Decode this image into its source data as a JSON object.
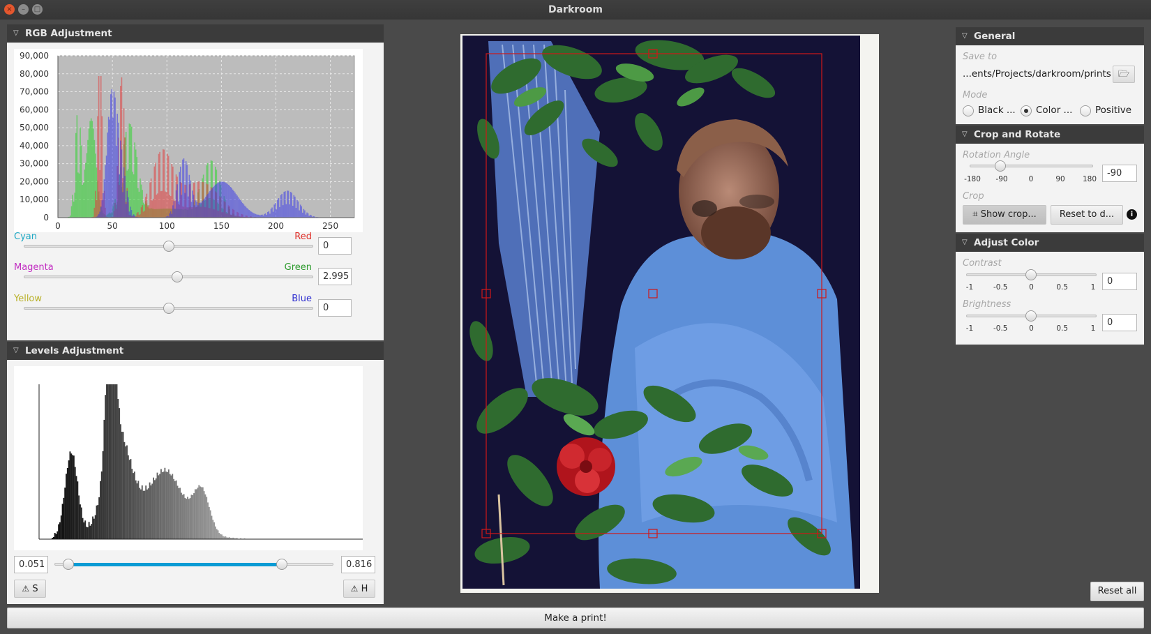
{
  "window": {
    "title": "Darkroom"
  },
  "rgb": {
    "title": "RGB Adjustment",
    "y_ticks": [
      "90,000",
      "80,000",
      "70,000",
      "60,000",
      "50,000",
      "40,000",
      "30,000",
      "20,000",
      "10,000",
      "0"
    ],
    "x_ticks": [
      "0",
      "50",
      "100",
      "150",
      "200",
      "250"
    ],
    "sliders": [
      {
        "left": "Cyan",
        "right": "Red",
        "value": "0",
        "left_color": "#1ea8c4",
        "right_color": "#e0302a",
        "level": 0.5
      },
      {
        "left": "Magenta",
        "right": "Green",
        "value": "2.995",
        "left_color": "#c22dc2",
        "right_color": "#2c9a2c",
        "level": 0.53
      },
      {
        "left": "Yellow",
        "right": "Blue",
        "value": "0",
        "left_color": "#b9b12a",
        "right_color": "#3030d0",
        "level": 0.5
      }
    ]
  },
  "levels": {
    "title": "Levels Adjustment",
    "low_value": "0.051",
    "high_value": "0.816",
    "low_fraction": 0.051,
    "high_fraction": 0.816,
    "shadows_button": "S",
    "highlights_button": "H"
  },
  "general": {
    "title": "General",
    "save_to_label": "Save to",
    "save_path": "...ents/Projects/darkroom/prints",
    "mode_label": "Mode",
    "modes": [
      {
        "label": "Black ...",
        "selected": false
      },
      {
        "label": "Color ...",
        "selected": true
      },
      {
        "label": "Positive",
        "selected": false
      }
    ]
  },
  "crop_rotate": {
    "title": "Crop and Rotate",
    "rotation_label": "Rotation Angle",
    "rotation_ticks": [
      "-180",
      "-90",
      "0",
      "90",
      "180"
    ],
    "rotation_value": "-90",
    "crop_label": "Crop",
    "show_crop": "Show crop...",
    "reset_default": "Reset to d..."
  },
  "adjust_color": {
    "title": "Adjust Color",
    "contrast_label": "Contrast",
    "contrast_value": "0",
    "brightness_label": "Brightness",
    "brightness_value": "0",
    "ticks": [
      "-1",
      "-0.5",
      "0",
      "0.5",
      "1"
    ]
  },
  "actions": {
    "reset_all": "Reset all",
    "make_print": "Make a print!"
  },
  "colors": {
    "accent": "#0a9bd4",
    "crop_frame": "#d01818"
  }
}
